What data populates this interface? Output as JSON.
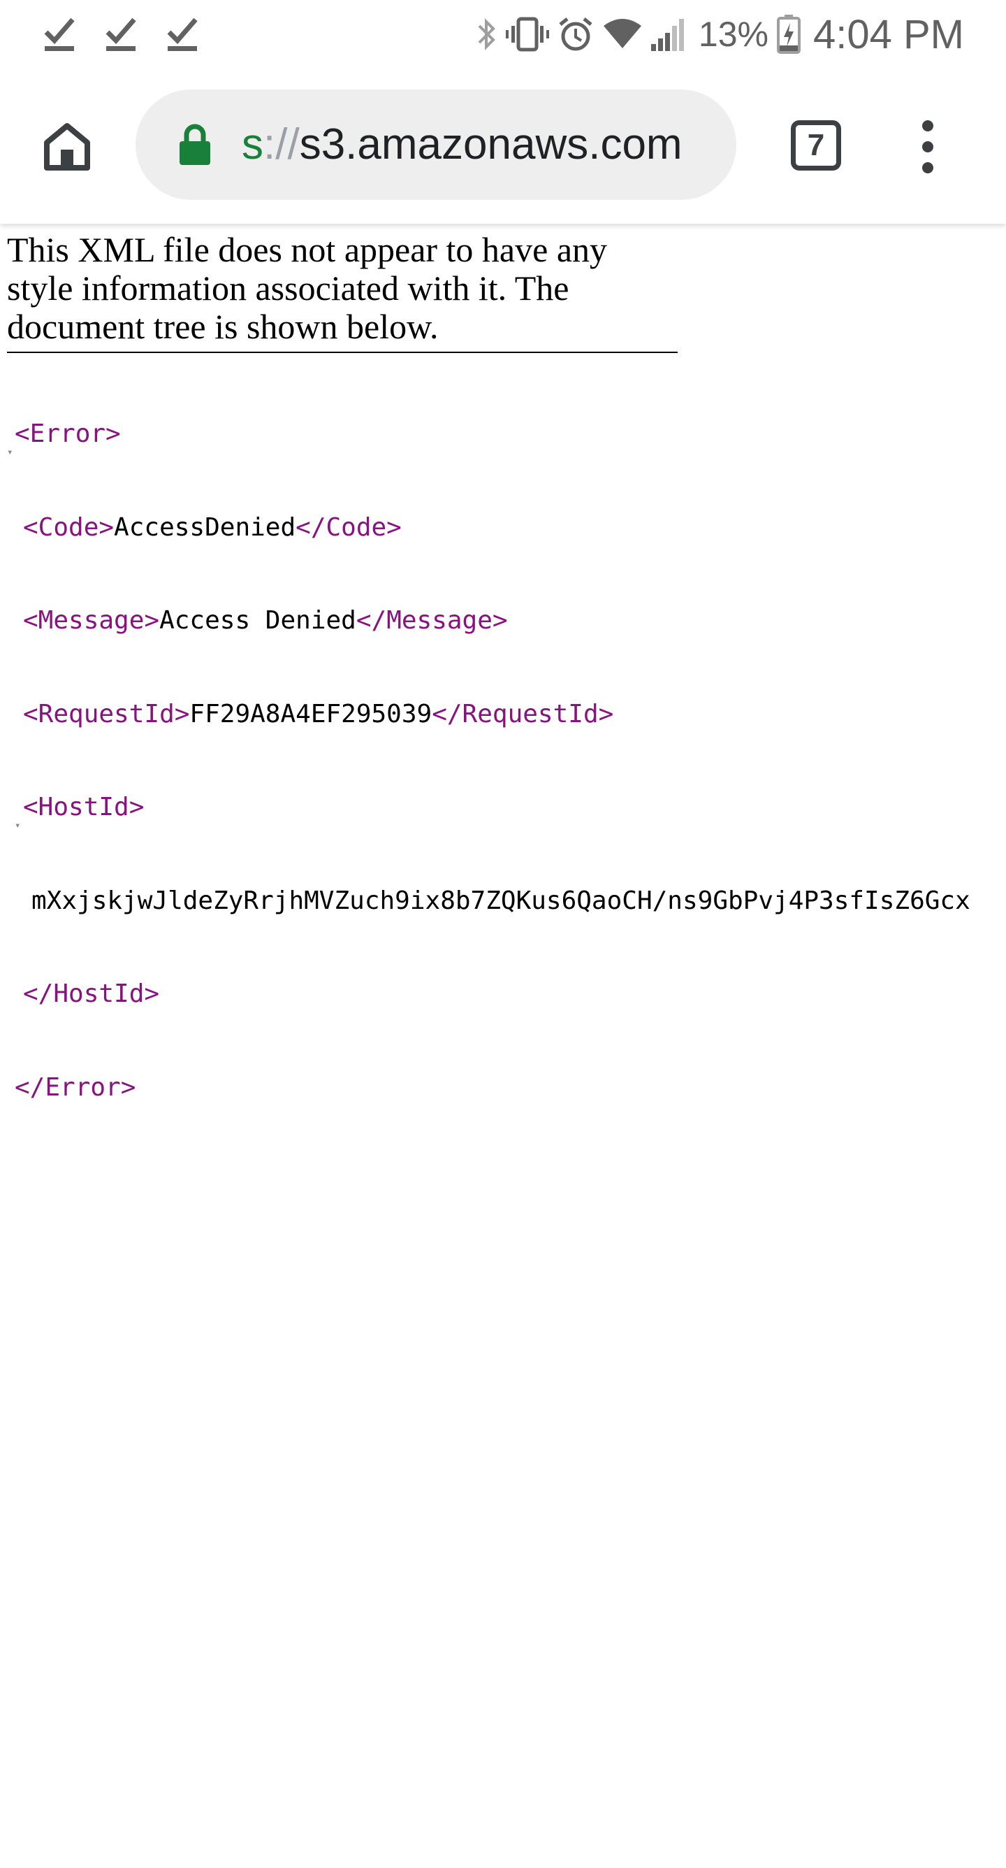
{
  "status_bar": {
    "notifications": [
      "download-done-icon",
      "download-done-icon",
      "download-done-icon"
    ],
    "icons": [
      "bluetooth-icon",
      "vibrate-icon",
      "alarm-icon",
      "wifi-icon",
      "signal-icon"
    ],
    "battery_percent": "13%",
    "time": "4:04 PM"
  },
  "toolbar": {
    "url_scheme_tail": "s",
    "url_separator": "://",
    "url_host": "s3.amazonaws.com",
    "tab_count": "7"
  },
  "page": {
    "info_message": "This XML file does not appear to have any style information associated with it. The document tree is shown below.",
    "xml": {
      "error_open": "<Error>",
      "error_close": "</Error>",
      "code_open": "<Code>",
      "code_value": "AccessDenied",
      "code_close": "</Code>",
      "message_open": "<Message>",
      "message_value": "Access Denied",
      "message_close": "</Message>",
      "request_id_open": "<RequestId>",
      "request_id_value": "FF29A8A4EF295039",
      "request_id_close": "</RequestId>",
      "host_id_open": "<HostId>",
      "host_id_value": "mXxjskjwJldeZyRrjhMVZuch9ix8b7ZQKus6QaoCH/ns9GbPvj4P3sfIsZ6Gcx",
      "host_id_close": "</HostId>"
    }
  },
  "colors": {
    "tag": "#881280",
    "url_scheme": "#188038",
    "lock": "#188038"
  }
}
